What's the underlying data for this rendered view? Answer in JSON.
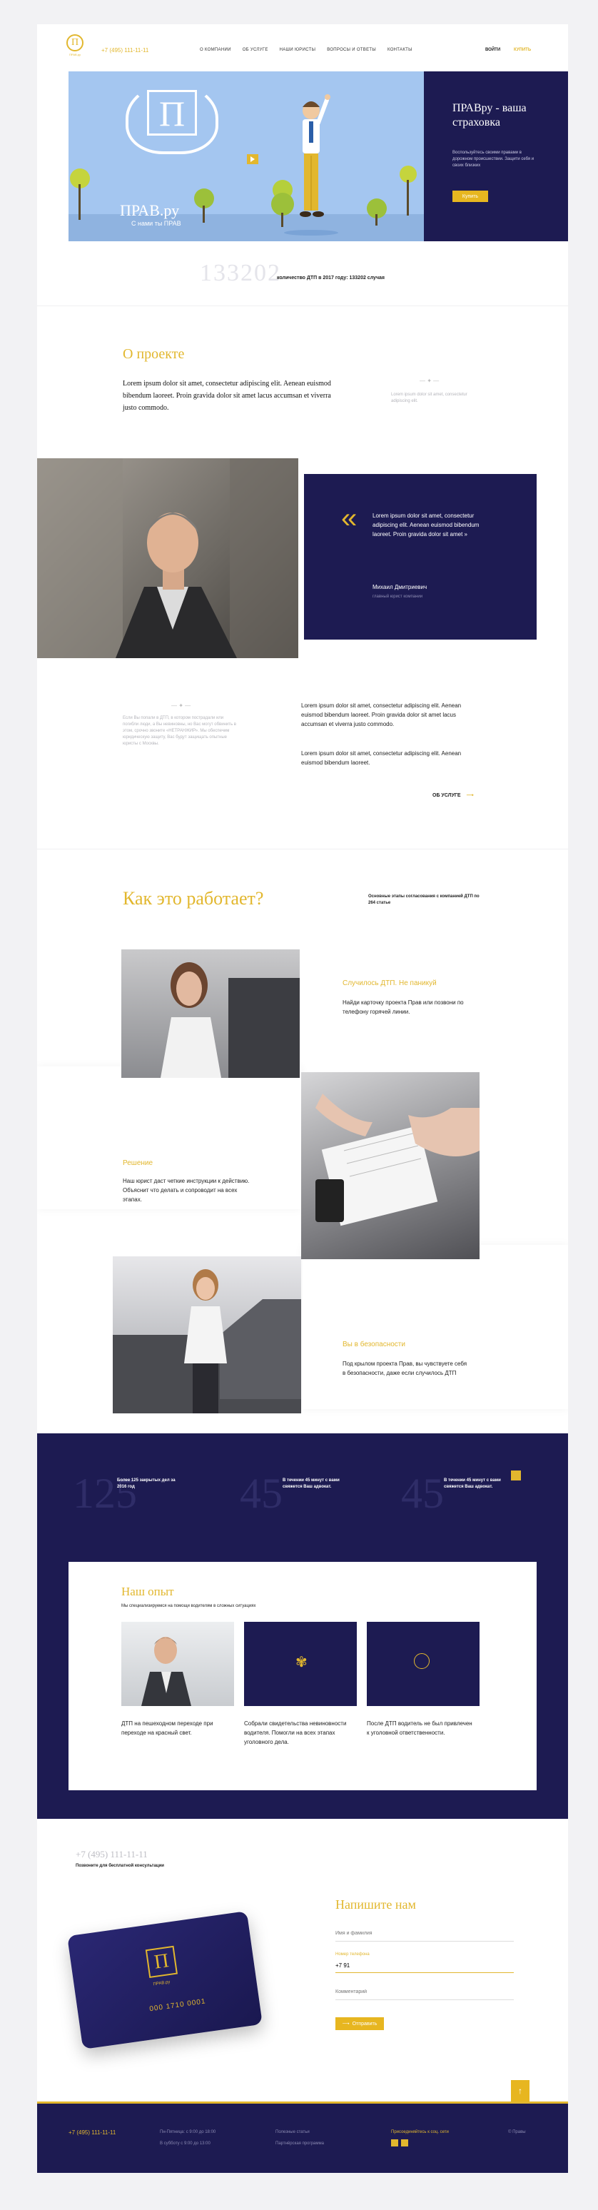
{
  "header": {
    "phone": "+7 (495) 111-11-11",
    "logo_letter": "П",
    "logo_sub": "ПРАВ.ру",
    "nav": [
      "О КОМПАНИИ",
      "ОБ УСЛУГЕ",
      "НАШИ ЮРИСТЫ",
      "ВОПРОСЫ И ОТВЕТЫ",
      "КОНТАКТЫ"
    ],
    "login": "ВОЙТИ",
    "buy": "КУПИТЬ"
  },
  "social": [
    "f",
    "vk"
  ],
  "hero": {
    "logo_letter": "П",
    "brand": "ПРАВ.ру",
    "tagline": "С нами ты ПРАВ",
    "title": "ПРАВру - ваша страховка",
    "text": "Воспользуйтесь своими правами в дорожном происшествии. Защити себя и своих близких",
    "button": "Купить"
  },
  "stats_bar": {
    "number": "133202",
    "text": "количество ДТП в 2017 году: 133202 случая"
  },
  "about": {
    "title": "О проекте",
    "lead": "Lorem ipsum dolor sit amet, consectetur adipiscing elit. Aenean euismod bibendum laoreet. Proin gravida dolor sit amet lacus accumsan et viverra justo commodo.",
    "side_text": "Lorem ipsum dolor sit amet, consectetur adipiscing elit."
  },
  "quote": {
    "mark": "«",
    "text": "Lorem ipsum dolor sit amet, consectetur adipiscing elit. Aenean euismod bibendum laoreet. Proin gravida dolor sit amet »",
    "author": "Михаил Дмитриевич",
    "role": "главный юрист компании"
  },
  "about2": {
    "left_text": "Если Вы попали в ДТП, в котором пострадали или погибли люди, а Вы невиновны, но Вас могут обвинить в этом, срочно звоните «НЕТРАНЖИР». Мы обеспечим юридическую защиту, Вас будут защищать опытные юристы с Москвы.",
    "para1": "Lorem ipsum dolor sit amet, consectetur adipiscing elit. Aenean euismod bibendum laoreet. Proin gravida dolor sit amet lacus accumsan et viverra justo commodo.",
    "para2": "Lorem ipsum dolor sit amet, consectetur adipiscing elit. Aenean euismod bibendum laoreet.",
    "link": "ОБ УСЛУГЕ"
  },
  "how": {
    "title": "Как это работает?",
    "subtitle": "Основные этапы согласования с компанией ДТП по 264 статье",
    "steps": [
      {
        "title": "Случилось ДТП. Не паникуй",
        "text": "Найди карточку проекта Прав или позвони по телефону горячей линии."
      },
      {
        "title": "Решение",
        "text": "Наш юрист даст четкие инструкции к действию. Объяснит что делать и сопроводит на всех этапах."
      },
      {
        "title": "Вы в безопасности",
        "text": "Под крылом проекта Прав, вы чувствуете себя в безопасности, даже если случилось ДТП"
      }
    ]
  },
  "stats": [
    {
      "big": "125",
      "text": "Более 125 закрытых дел за 2016 год"
    },
    {
      "big": "45",
      "text": "В течении 45 минут с вами свяжется Ваш адвокат."
    },
    {
      "big": "45",
      "text": "В течении 45 минут с вами свяжется Ваш адвокат."
    }
  ],
  "experience": {
    "title": "Наш опыт",
    "subtitle": "Мы специализируемся на помощи водителям в сложных ситуациях",
    "cards": [
      {
        "text": "ДТП на пешеходном переходе при переходе на красный свет."
      },
      {
        "text": "Собрали свидетельства невиновности водителя. Помогли на всех этапах уголовного дела."
      },
      {
        "text": "После ДТП водитель не был привлечен к уголовной ответственности."
      }
    ]
  },
  "contact": {
    "phone": "+7 (495) 111-11-11",
    "phone_caption": "Позвоните для бесплатной консультации",
    "card_number": "000 1710 0001",
    "card_brand": "ПРАВ.ру",
    "card_letter": "П",
    "title": "Напишите нам",
    "name_placeholder": "Имя и фамилия",
    "phone_label": "Номер телефона",
    "phone_value": "+7 91",
    "comment_placeholder": "Комментарий",
    "submit": "Отправить"
  },
  "footer": {
    "phone": "+7 (495) 111-11-11",
    "hours1": "Пн-Пятница: с 9:00 до 18:00",
    "hours2": "В субботу с 9:00 до 13:00",
    "link1": "Полезные статьи",
    "link2": "Партнёрская программа",
    "join": "Присоединяйтесь к соц. сети",
    "copyright": "© Правы"
  },
  "colors": {
    "navy": "#1d1b52",
    "gold": "#e2b72e",
    "hero_sky": "#a4c6f0"
  }
}
